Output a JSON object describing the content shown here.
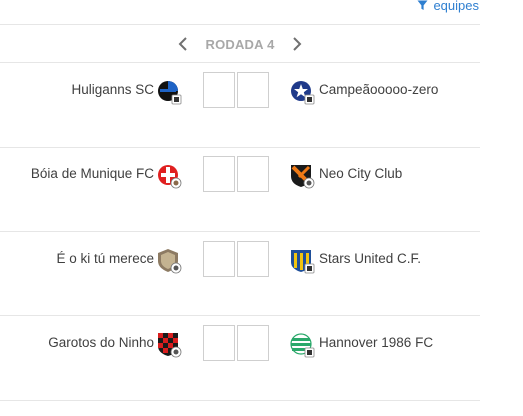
{
  "filter": {
    "label": "equipes",
    "icon": "filter-icon"
  },
  "round": {
    "label": "RODADA 4",
    "prev_icon": "chevron-left-icon",
    "next_icon": "chevron-right-icon"
  },
  "colors": {
    "accent": "#2f7fd0",
    "muted": "#a8a8a8",
    "text": "#404040",
    "divider": "#e6e6e6"
  },
  "matches": [
    {
      "home": {
        "name": "Huliganns SC",
        "badge": "black-blue-crest-icon"
      },
      "away": {
        "name": "Campeãooooo-zero",
        "badge": "blue-star-crest-icon"
      },
      "home_score": "",
      "away_score": ""
    },
    {
      "home": {
        "name": "Bóia de Munique FC",
        "badge": "red-cross-crest-icon"
      },
      "away": {
        "name": "Neo City Club",
        "badge": "orange-shield-crest-icon"
      },
      "home_score": "",
      "away_score": ""
    },
    {
      "home": {
        "name": "É o ki tú merece",
        "badge": "beige-shield-crest-icon"
      },
      "away": {
        "name": "Stars United C.F.",
        "badge": "blue-yellow-stripes-crest-icon"
      },
      "home_score": "",
      "away_score": ""
    },
    {
      "home": {
        "name": "Garotos do Ninho",
        "badge": "red-black-checkered-crest-icon"
      },
      "away": {
        "name": "Hannover 1986 FC",
        "badge": "green-hoops-crest-icon"
      },
      "home_score": "",
      "away_score": ""
    }
  ]
}
